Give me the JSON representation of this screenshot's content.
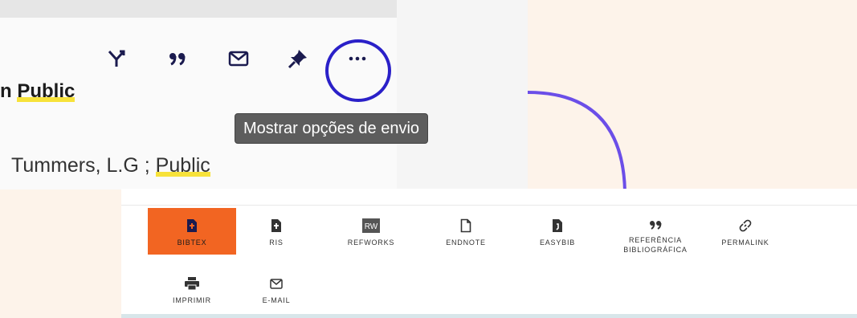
{
  "top_panel": {
    "title_fragment_prefix": "n ",
    "title_fragment_highlight": "Public",
    "author_prefix": "Tummers, L.G ; ",
    "author_highlight": "Public",
    "tooltip": "Mostrar opções de envio",
    "toolbar_icons": [
      "fork-icon",
      "quote-icon",
      "envelope-icon",
      "pin-icon",
      "more-options-icon"
    ]
  },
  "send_options": {
    "items": [
      {
        "label": "BIBTEX",
        "icon": "bibtex-file-icon",
        "active": true
      },
      {
        "label": "RIS",
        "icon": "ris-file-icon"
      },
      {
        "label": "REFWORKS",
        "icon": "refworks-icon",
        "icon_text": "RW"
      },
      {
        "label": "ENDNOTE",
        "icon": "endnote-file-icon"
      },
      {
        "label": "EASYBIB",
        "icon": "easybib-file-icon"
      },
      {
        "label": "REFERÊNCIA BIBLIOGRÁFICA",
        "icon": "quote-icon"
      },
      {
        "label": "PERMALINK",
        "icon": "link-icon"
      },
      {
        "label": "IMPRIMIR",
        "icon": "printer-icon"
      },
      {
        "label": "E-MAIL",
        "icon": "envelope-icon"
      }
    ]
  },
  "colors": {
    "accent_orange": "#f26522",
    "circle_blue": "#2a20c8",
    "connector_purple": "#6b4ee8",
    "icon_navy": "#1b1b4f",
    "highlight_yellow": "#f7e23a"
  }
}
